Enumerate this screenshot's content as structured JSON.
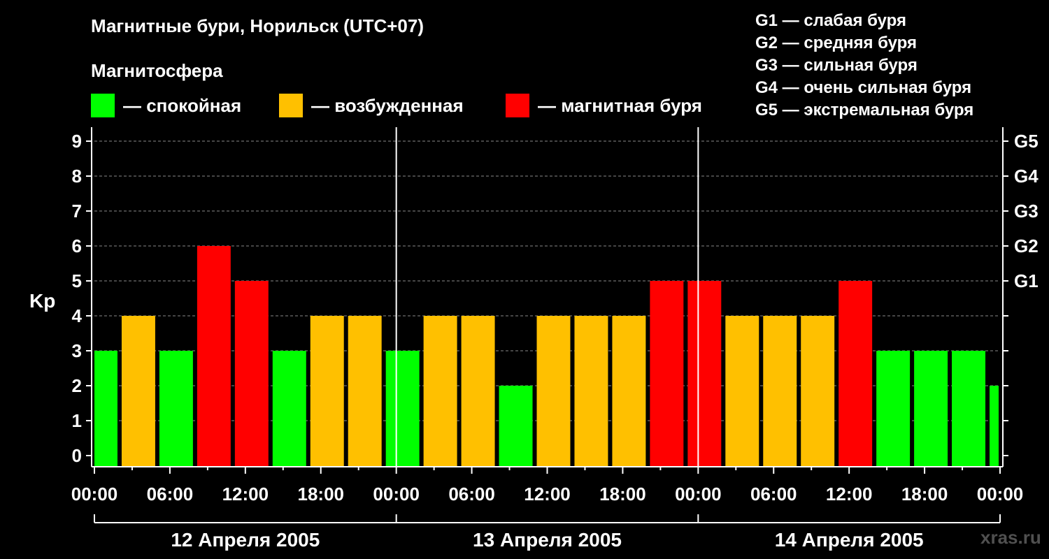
{
  "header": {
    "title": "Магнитные бури, Норильск (UTC+07)",
    "subtitle": "Магнитосфера"
  },
  "legend": [
    {
      "label": "— спокойная",
      "color": "#00ff00"
    },
    {
      "label": "— возбужденная",
      "color": "#ffc000"
    },
    {
      "label": "— магнитная буря",
      "color": "#ff0000"
    }
  ],
  "g_scale": [
    "G1 — слабая буря",
    "G2 — средняя буря",
    "G3 — сильная буря",
    "G4 — очень сильная буря",
    "G5 — экстремальная буря"
  ],
  "watermark": "xras.ru",
  "chart_data": {
    "type": "bar",
    "ylabel": "Kp",
    "ylim": [
      0,
      9
    ],
    "y_ticks": [
      0,
      1,
      2,
      3,
      4,
      5,
      6,
      7,
      8,
      9
    ],
    "right_axis_labels": [
      {
        "value": 5,
        "label": "G1"
      },
      {
        "value": 6,
        "label": "G2"
      },
      {
        "value": 7,
        "label": "G3"
      },
      {
        "value": 8,
        "label": "G4"
      },
      {
        "value": 9,
        "label": "G5"
      }
    ],
    "x_tick_labels": [
      "00:00",
      "06:00",
      "12:00",
      "18:00",
      "00:00",
      "06:00",
      "12:00",
      "18:00",
      "00:00",
      "06:00",
      "12:00",
      "18:00",
      "00:00"
    ],
    "days": [
      "12 Апреля 2005",
      "13 Апреля 2005",
      "14 Апреля 2005"
    ],
    "bar_interval_hours": 3,
    "first_bar_offset_hours": -1,
    "values": [
      3,
      4,
      3,
      6,
      5,
      3,
      4,
      4,
      3,
      4,
      4,
      2,
      4,
      4,
      4,
      5,
      5,
      4,
      4,
      4,
      5,
      3,
      3,
      3,
      2
    ],
    "level_colors": {
      "quiet": "#00ff00",
      "active": "#ffc000",
      "storm": "#ff0000"
    },
    "grid": true
  }
}
